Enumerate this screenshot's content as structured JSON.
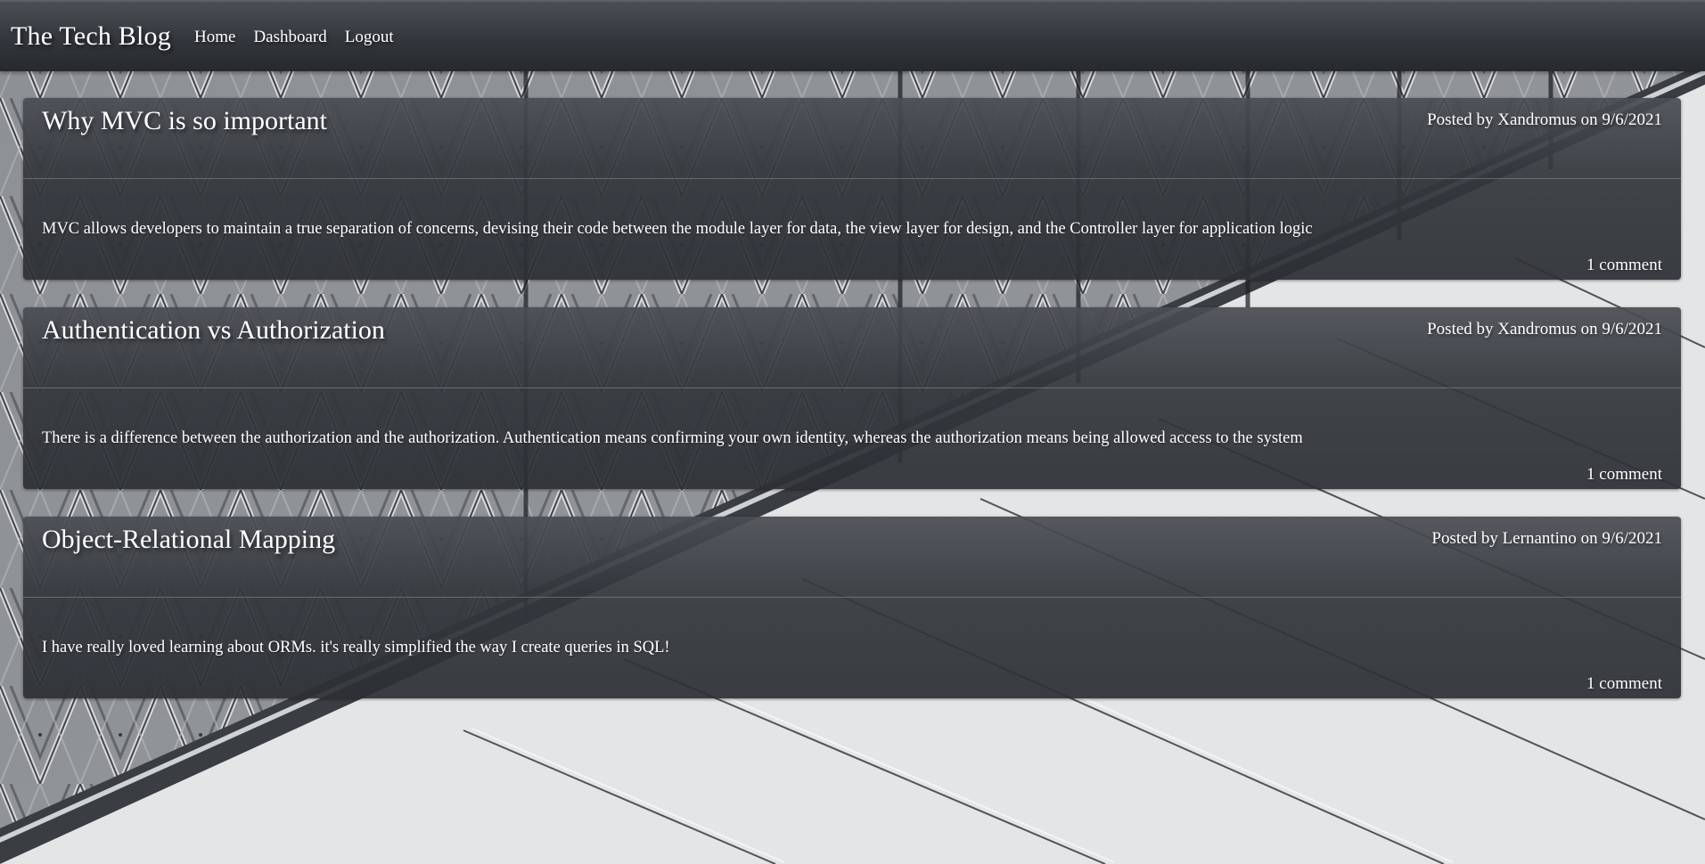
{
  "navbar": {
    "brand": "The Tech Blog",
    "links": [
      {
        "label": "Home"
      },
      {
        "label": "Dashboard"
      },
      {
        "label": "Logout"
      }
    ]
  },
  "posts": [
    {
      "title": "Why MVC is so important",
      "meta": "Posted by Xandromus on 9/6/2021",
      "body": "MVC allows developers to maintain a true separation of concerns, devising their code between the module layer for data, the view layer for design, and the Controller layer for application logic",
      "comments": "1 comment"
    },
    {
      "title": "Authentication vs Authorization",
      "meta": "Posted by Xandromus on 9/6/2021",
      "body": "There is a difference between the authorization and the authorization. Authentication means confirming your own identity, whereas the authorization means being allowed access to the system",
      "comments": "1 comment"
    },
    {
      "title": "Object-Relational Mapping",
      "meta": "Posted by Lernantino on 9/6/2021",
      "body": "I have really loved learning about ORMs. it's really simplified the way I create queries in SQL!",
      "comments": "1 comment"
    }
  ],
  "colors": {
    "navbar": "#33373c",
    "card": "#3a3e43",
    "text": "#ffffff",
    "background": "#e9eaeb"
  }
}
